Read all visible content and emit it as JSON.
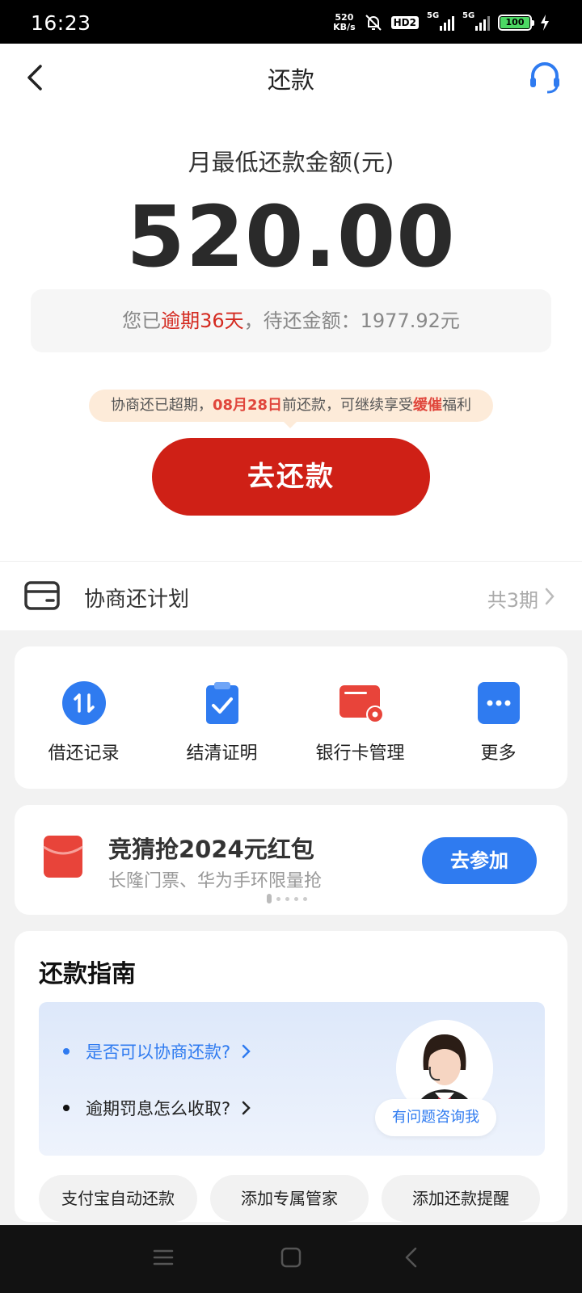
{
  "status_bar": {
    "time": "16:23",
    "speed_value": "520",
    "speed_unit": "KB/s",
    "hd_badge": "HD2",
    "network_1": "5G",
    "network_2": "5G",
    "battery": "100",
    "icons": [
      "mute-bell-icon",
      "signal-icon",
      "battery-icon",
      "charging-icon"
    ]
  },
  "header": {
    "title": "还款",
    "back_icon": "chevron-left-icon",
    "service_icon": "headset-icon"
  },
  "summary": {
    "min_label": "月最低还款金额(元)",
    "min_amount": "520.00",
    "overdue_prefix": "您已",
    "overdue_highlight": "逾期36天",
    "overdue_suffix": "，待还金额：1977.92元"
  },
  "tip": {
    "part1": "协商还已超期，",
    "date": "08月28日",
    "part2": "前还款，可继续享受",
    "highlight": "缓催",
    "part3": "福利"
  },
  "repay_button": "去还款",
  "plan": {
    "label": "协商还计划",
    "count": "共3期",
    "icon": "card-icon"
  },
  "shortcuts": [
    {
      "label": "借还记录",
      "icon": "transfer-icon"
    },
    {
      "label": "结清证明",
      "icon": "clipboard-check-icon"
    },
    {
      "label": "银行卡管理",
      "icon": "bank-card-gear-icon"
    },
    {
      "label": "更多",
      "icon": "more-dots-icon"
    }
  ],
  "promo": {
    "title": "竞猜抢2024元红包",
    "subtitle": "长隆门票、华为手环限量抢",
    "button": "去参加",
    "icon": "red-envelope-icon"
  },
  "guide": {
    "title": "还款指南",
    "questions": [
      "是否可以协商还款?",
      "逾期罚息怎么收取?"
    ],
    "ask_label": "有问题咨询我",
    "chips": [
      "支付宝自动还款",
      "添加专属管家",
      "添加还款提醒"
    ]
  },
  "colors": {
    "primary_red": "#cf2016",
    "accent_blue": "#2f7bf0",
    "tip_bg": "#fdebd9"
  }
}
